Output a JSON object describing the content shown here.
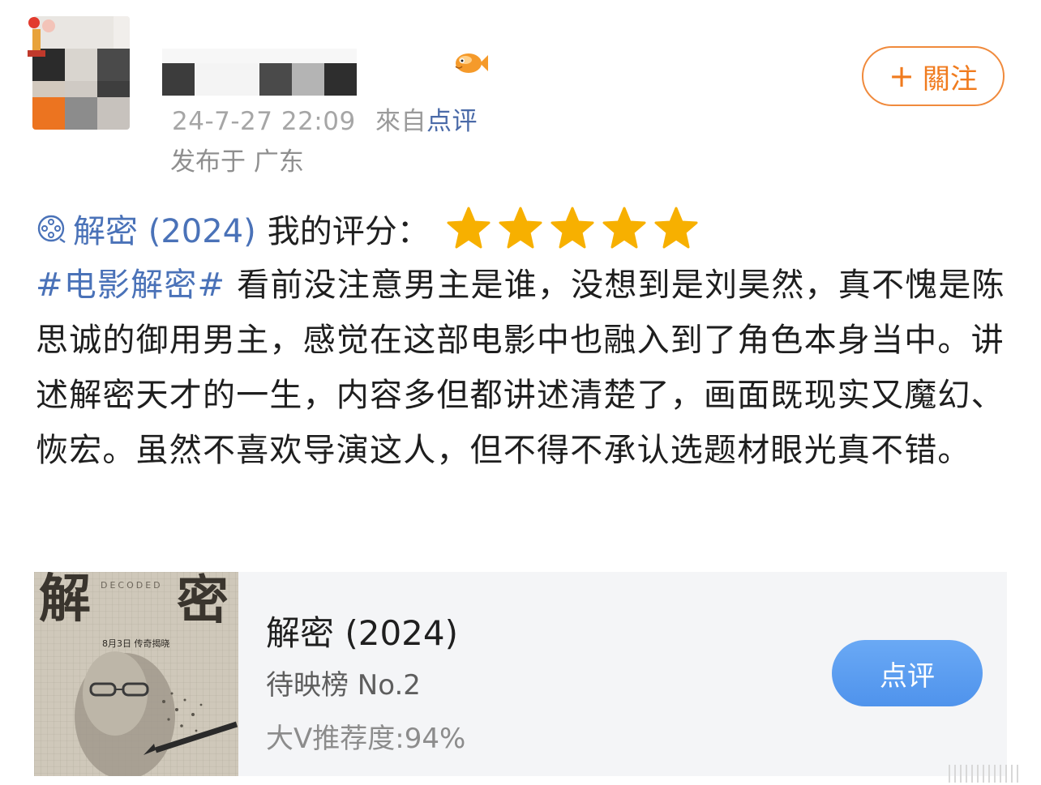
{
  "post": {
    "timestamp": "24-7-27 22:09",
    "source_prefix": "來自",
    "source_name": "点评",
    "location": "发布于 广东",
    "follow_label": "關注",
    "movie_link": "解密 (2024)",
    "rating_label": "我的评分：",
    "rating_stars": 5,
    "hashtag": "#电影解密#",
    "body": " 看前没注意男主是谁，没想到是刘昊然，真不愧是陈思诚的御用男主，感觉在这部电影中也融入到了角色本身当中。讲述解密天才的一生，内容多但都讲述清楚了，画面既现实又魔幻、恢宏。虽然不喜欢导演这人，但不得不承认选题材眼光真不错。"
  },
  "card": {
    "title": "解密 (2024)",
    "rank": "待映榜 No.2",
    "recommend": "大V推荐度:94%",
    "action_label": "点评",
    "poster": {
      "title_chars": [
        "解",
        "密"
      ],
      "english": "DECODED",
      "release": "8月3日 传奇揭晓"
    }
  },
  "colors": {
    "link": "#4a72b8",
    "accent_orange": "#f07b1e",
    "star": "#f7b000",
    "button_blue": "#5b9df0"
  }
}
